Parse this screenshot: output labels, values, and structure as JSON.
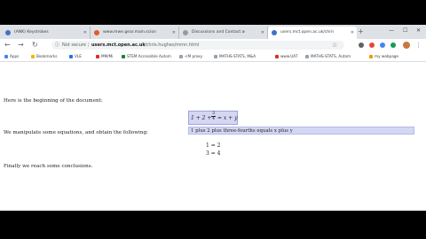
{
  "tabs": [
    {
      "label": "(ANK) Keystrokes",
      "color": "#4a6fc9",
      "active": false
    },
    {
      "label": "www.mwe.gear.main.scions.a",
      "color": "#e05c2a",
      "active": false
    },
    {
      "label": "Discussions and Contact accessi",
      "color": "#9a9a9a",
      "active": false
    },
    {
      "label": "users.mct.open.ac.uk/chris.hug",
      "color": "#3b73c6",
      "active": true
    }
  ],
  "toolbar": {
    "secure_text": "Not secure",
    "url_host": "users.mct.open.ac.uk",
    "url_path": "/chris.hughes/mmn.html"
  },
  "bookmarks": [
    {
      "label": "Apps",
      "color": "#4285f4"
    },
    {
      "label": "Bookmarks",
      "color": "#f2b400"
    },
    {
      "label": "VLE",
      "color": "#1a73e8"
    },
    {
      "label": "MM/Mi",
      "color": "#d93025"
    },
    {
      "label": "STEM Accessible Autom",
      "color": "#188038"
    },
    {
      "label": "<M proxy",
      "color": "#9aa0a6"
    },
    {
      "label": "MATHS-STATS, M&A",
      "color": "#9aa0a6"
    },
    {
      "label": "www.UAT",
      "color": "#d93025"
    },
    {
      "label": "MATHS-STATS, Autom",
      "color": "#9aa0a6"
    },
    {
      "label": "my webpage",
      "color": "#f29900"
    }
  ],
  "document": {
    "intro": "Here is the beginning of the document:",
    "math_left": "1 + 2 +",
    "frac_num": "3",
    "frac_den": "4",
    "math_right": "= x + y",
    "speech": "1 plus 2 plus three-fourths equals x plus y",
    "manipulate": "We manipulate some equations, and obtain the following:",
    "eq1": "1 = 2",
    "eq2": "3 = 4",
    "conclusion": "Finally we reach some conclusions."
  }
}
